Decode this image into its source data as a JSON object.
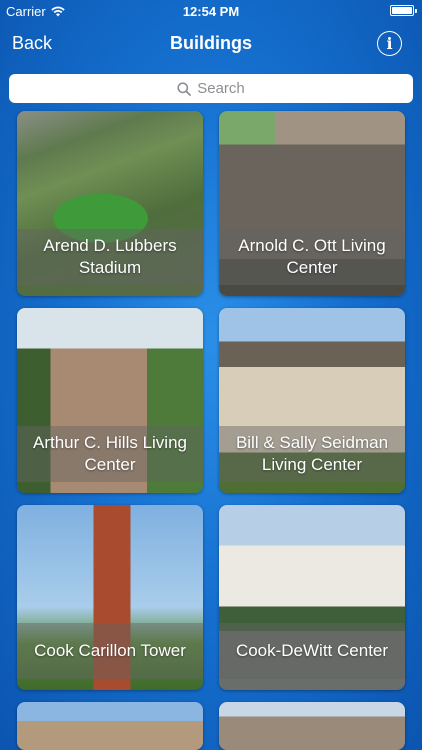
{
  "status_bar": {
    "carrier": "Carrier",
    "time": "12:54 PM"
  },
  "nav": {
    "back_label": "Back",
    "title": "Buildings",
    "info_label": "i"
  },
  "search": {
    "placeholder": "Search"
  },
  "buildings": [
    {
      "name": "Arend D. Lubbers Stadium"
    },
    {
      "name": "Arnold C. Ott Living Center"
    },
    {
      "name": "Arthur C. Hills Living Center"
    },
    {
      "name": "Bill & Sally Seidman Living Center"
    },
    {
      "name": "Cook Carillon Tower"
    },
    {
      "name": "Cook-DeWitt Center"
    }
  ],
  "colors": {
    "background": "#1670cf",
    "caption_overlay": "rgba(100,100,100,0.45)"
  }
}
